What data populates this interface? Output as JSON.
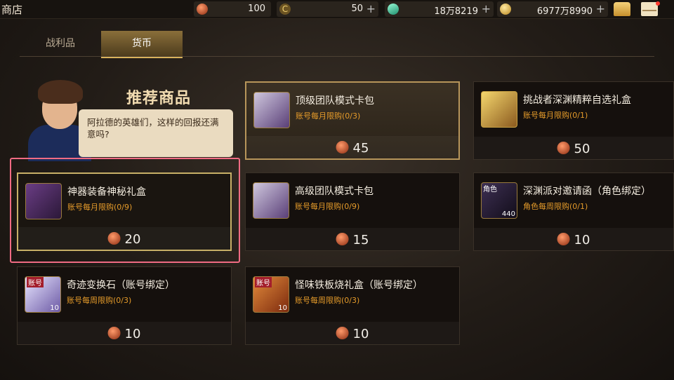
{
  "header": {
    "title": "商店",
    "resources": [
      {
        "icon": "orb-currency-icon",
        "value": "100"
      },
      {
        "icon": "c-currency-icon",
        "value": "50"
      },
      {
        "icon": "gem-currency-icon",
        "value": "18万8219"
      },
      {
        "icon": "gold-coin-icon",
        "value": "6977万8990"
      }
    ],
    "plus": "+"
  },
  "tabs": [
    {
      "label": "战利品",
      "active": false
    },
    {
      "label": "货币",
      "active": true
    }
  ],
  "promo": {
    "heading": "推荐商品",
    "speech": "阿拉德的英雄们，这样的回报还满意吗?"
  },
  "items": [
    {
      "name": "顶级团队模式卡包",
      "limit": "账号每月限购(0/3)",
      "price": "45",
      "icon": "card-pack-icon"
    },
    {
      "name": "挑战者深渊精粹自选礼盒",
      "limit": "账号每月限购(0/1)",
      "price": "50",
      "icon": "golden-gift-box-icon"
    },
    {
      "name": "神器装备神秘礼盒",
      "limit": "账号每月限购(0/9)",
      "price": "20",
      "icon": "mystery-chest-icon"
    },
    {
      "name": "高级团队模式卡包",
      "limit": "账号每月限购(0/9)",
      "price": "15",
      "icon": "card-pack-icon"
    },
    {
      "name": "深渊派对邀请函（角色绑定）",
      "limit": "角色每周限购(0/1)",
      "price": "10",
      "icon": "invitation-ticket-icon",
      "badge": "440",
      "tag": "角色"
    },
    {
      "name": "奇迹变换石（账号绑定）",
      "limit": "账号每周限购(0/3)",
      "price": "10",
      "icon": "crystal-stone-icon",
      "badge": "10",
      "tag": "账号"
    },
    {
      "name": "怪味铁板烧礼盒（账号绑定）",
      "limit": "账号每周限购(0/3)",
      "price": "10",
      "icon": "food-gift-box-icon",
      "badge": "10",
      "tag": "账号"
    }
  ]
}
